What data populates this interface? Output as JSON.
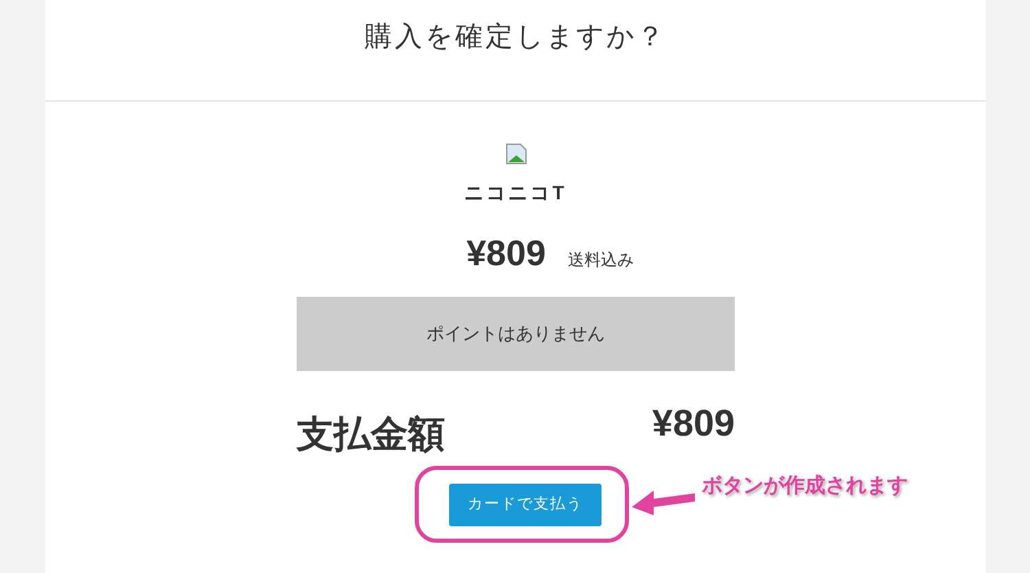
{
  "title": "購入を確定しますか？",
  "product": {
    "name": "ニコニコT",
    "price": "¥809",
    "shipping_note": "送料込み"
  },
  "points_notice": "ポイントはありません",
  "total": {
    "label": "支払金額",
    "amount": "¥809"
  },
  "pay_button": "カードで支払う",
  "annotation": "ボタンが作成されます"
}
